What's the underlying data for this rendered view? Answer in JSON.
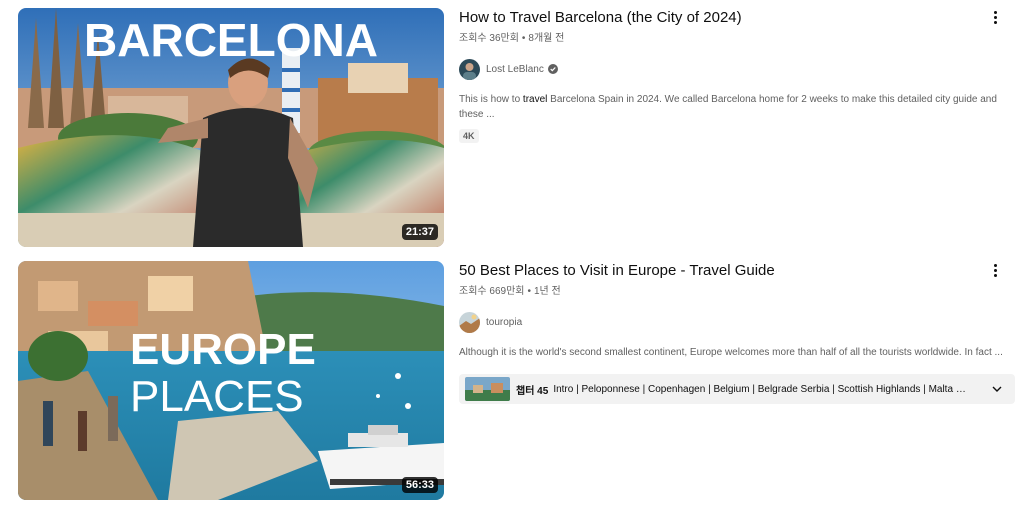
{
  "results": [
    {
      "title": "How to Travel Barcelona (the City of 2024)",
      "views": "조회수 36만회",
      "age": "8개월 전",
      "channel": "Lost LeBlanc",
      "verified": true,
      "description_before": "This is how to ",
      "description_bold": "travel",
      "description_after": " Barcelona Spain in 2024. We called Barcelona home for 2 weeks to make this detailed city guide and these ...",
      "badge": "4K",
      "duration": "21:37",
      "thumbnail_text": "BARCELONA",
      "icons": {
        "verified": "verified-check-icon",
        "more": "more-vert-icon"
      }
    },
    {
      "title": "50 Best Places to Visit in Europe - Travel Guide",
      "views": "조회수 669만회",
      "age": "1년 전",
      "channel": "touropia",
      "description": "Although it is the world's second smallest continent, Europe welcomes more than half of all the tourists worldwide. In fact ...",
      "chapters_label": "챕터 45",
      "chapters_list": "Intro | Peloponnese | Copenhagen | Belgium | Belgrade Serbia | Scottish Highlands | Malta | ...",
      "duration": "56:33",
      "thumbnail_line1": "EUROPE",
      "thumbnail_line2": "PLACES",
      "icons": {
        "more": "more-vert-icon",
        "expand": "chevron-down-icon"
      }
    }
  ]
}
